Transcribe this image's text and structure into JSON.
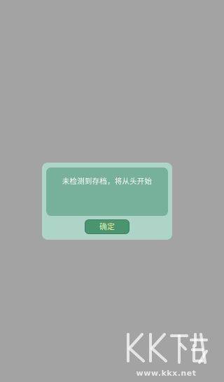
{
  "dialog": {
    "message": "未检测到存档，将从头开始",
    "confirm_label": "确定"
  },
  "watermark": {
    "logo_text": "KK下载",
    "url": "www.kkx.net"
  },
  "colors": {
    "background": "#a3a3a3",
    "dialog_outer": "#aed4c7",
    "dialog_inner": "#77b09b",
    "button": "#4a9470",
    "button_text": "#f2f0a4"
  }
}
